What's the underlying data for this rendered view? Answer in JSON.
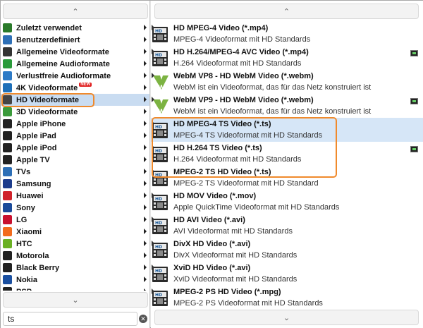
{
  "categories": [
    {
      "label": "Zuletzt verwendet",
      "icon": "clock-icon",
      "color": "#2a7a2a"
    },
    {
      "label": "Benutzerdefiniert",
      "icon": "user-settings-icon",
      "color": "#2d6fb6"
    },
    {
      "label": "Allgemeine Videoformate",
      "icon": "film-icon",
      "color": "#333333"
    },
    {
      "label": "Allgemeine Audioformate",
      "icon": "music-note-icon",
      "color": "#2a9a3a"
    },
    {
      "label": "Verlustfreie Audioformate",
      "icon": "music-note-icon",
      "color": "#2d7ac6"
    },
    {
      "label": "4K Videoformate",
      "icon": "4k-icon",
      "color": "#1e6fb8",
      "badge": "NEW"
    },
    {
      "label": "HD Videoformate",
      "icon": "hd-icon",
      "color": "#444444",
      "selected": true
    },
    {
      "label": "3D Videoformate",
      "icon": "3d-icon",
      "color": "#3a9a3a"
    },
    {
      "label": "Apple iPhone",
      "icon": "iphone-icon",
      "color": "#222222"
    },
    {
      "label": "Apple iPad",
      "icon": "ipad-icon",
      "color": "#222222"
    },
    {
      "label": "Apple iPod",
      "icon": "ipod-icon",
      "color": "#222222"
    },
    {
      "label": "Apple TV",
      "icon": "apple-tv-icon",
      "color": "#222222"
    },
    {
      "label": "TVs",
      "icon": "tv-icon",
      "color": "#2d6fb6"
    },
    {
      "label": "Samsung",
      "icon": "samsung-icon",
      "color": "#1c3c8c"
    },
    {
      "label": "Huawei",
      "icon": "huawei-icon",
      "color": "#d0222a"
    },
    {
      "label": "Sony",
      "icon": "sony-icon",
      "color": "#1a4a9a"
    },
    {
      "label": "LG",
      "icon": "lg-icon",
      "color": "#c8102e"
    },
    {
      "label": "Xiaomi",
      "icon": "xiaomi-icon",
      "color": "#f26b1d"
    },
    {
      "label": "HTC",
      "icon": "htc-icon",
      "color": "#6ab023"
    },
    {
      "label": "Motorola",
      "icon": "motorola-icon",
      "color": "#222222"
    },
    {
      "label": "Black Berry",
      "icon": "blackberry-icon",
      "color": "#222222"
    },
    {
      "label": "Nokia",
      "icon": "nokia-icon",
      "color": "#1a4fa0"
    },
    {
      "label": "PSP",
      "icon": "psp-icon",
      "color": "#222222"
    }
  ],
  "formats": [
    {
      "title": "HD MPEG-4 Video (*.mp4)",
      "desc": "MPEG-4 Videoformat mit HD Standards",
      "icon": "hd-film-icon",
      "badge": false
    },
    {
      "title": "HD H.264/MPEG-4 AVC Video (*.mp4)",
      "desc": "H.264 Videoformat mit HD Standards",
      "icon": "hd-film-icon",
      "badge": true
    },
    {
      "title": "WebM VP8 - HD WebM Video (*.webm)",
      "desc": "WebM ist ein Videoformat, das für das Netz konstruiert ist",
      "icon": "webm-icon",
      "badge": false
    },
    {
      "title": "WebM VP9 - HD WebM Video (*.webm)",
      "desc": "WebM ist ein Videoformat, das für das Netz konstruiert ist",
      "icon": "webm-icon",
      "badge": true
    },
    {
      "title": "HD MPEG-4 TS Video (*.ts)",
      "desc": "MPEG-4 TS Videoformat mit HD Standards",
      "icon": "hd-film-icon",
      "badge": false,
      "selected": true
    },
    {
      "title": "HD H.264 TS Video (*.ts)",
      "desc": "H.264 Videoformat mit HD Standards",
      "icon": "hd-film-icon",
      "badge": true
    },
    {
      "title": "MPEG-2 TS HD Video (*.ts)",
      "desc": "MPEG-2 TS Videoformat mit HD Standard",
      "icon": "hd-film-icon",
      "badge": false
    },
    {
      "title": "HD MOV Video (*.mov)",
      "desc": "Apple QuickTime Videoformat mit HD Standards",
      "icon": "hd-film-icon",
      "badge": false
    },
    {
      "title": "HD AVI Video (*.avi)",
      "desc": "AVI Videoformat mit HD Standards",
      "icon": "hd-film-icon",
      "badge": false
    },
    {
      "title": "DivX HD Video (*.avi)",
      "desc": "DivX Videoformat mit HD Standards",
      "icon": "hd-film-icon",
      "badge": false
    },
    {
      "title": "XviD HD Video (*.avi)",
      "desc": "XviD Videoformat mit HD Standards",
      "icon": "hd-film-icon",
      "badge": false
    },
    {
      "title": "MPEG-2 PS HD Video (*.mpg)",
      "desc": "MPEG-2 PS Videoformat mit HD Standards",
      "icon": "hd-film-icon",
      "badge": false
    }
  ],
  "search": {
    "value": "ts",
    "clear_icon": "clear-icon"
  },
  "colors": {
    "highlight": "#f08a2c",
    "selected_row": "#d6e6f7",
    "webm_green": "#7cb342"
  }
}
